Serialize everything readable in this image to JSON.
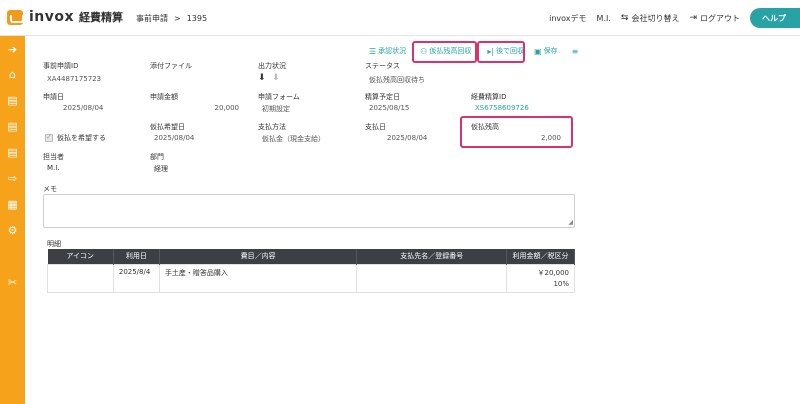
{
  "brand": {
    "logo_text": "invox",
    "logo_sub": "経費精算"
  },
  "breadcrumb": {
    "parent": "事前申請",
    "separator": ">",
    "current": "1395"
  },
  "topright": {
    "org": "invoxデモ",
    "user": "M.I.",
    "switch_company": "会社切り替え",
    "logout": "ログアウト",
    "help": "ヘルプ"
  },
  "toolbar": {
    "approval_status": "承認状況",
    "advance_collect": "仮払残高回収",
    "collect_later": "後で回収",
    "save": "保存"
  },
  "fields": {
    "request_id_label": "事前申請ID",
    "request_id": "XA4487175723",
    "attachment_label": "添付ファイル",
    "output_status_label": "出力状況",
    "status_label": "ステータス",
    "status": "仮払残高回収待ち",
    "request_date_label": "申請日",
    "request_date": "2025/08/04",
    "amount_label": "申請金額",
    "amount": "20,000",
    "form_label": "申請フォーム",
    "form": "初期設定",
    "settle_date_label": "精算予定日",
    "settle_date": "2025/08/15",
    "expense_id_label": "経費精算ID",
    "expense_id": "XS6758609726",
    "advance_wish_date_label": "仮払希望日",
    "advance_wish_date": "2025/08/04",
    "payment_method_label": "支払方法",
    "payment_method": "仮払金（現金支給）",
    "payment_date_label": "支払日",
    "payment_date": "2025/08/04",
    "advance_balance_label": "仮払残高",
    "advance_balance": "2,000",
    "wish_advance_label": "仮払を希望する",
    "person_label": "担当者",
    "person": "M.I.",
    "dept_label": "部門",
    "dept": "経理",
    "memo_label": "メモ",
    "detail_label": "明細"
  },
  "table": {
    "headers": [
      "アイコン",
      "利用日",
      "費目／内容",
      "支払先名／登録番号",
      "利用金額／税区分"
    ],
    "rows": [
      {
        "icon": "",
        "date": "2025/8/4",
        "item": "手土産・贈答品購入",
        "payee": "",
        "amount": "￥20,000",
        "tax": "10%"
      }
    ]
  },
  "colors": {
    "accent": "#27a3a6",
    "sidebar": "#f6a21b",
    "highlight": "#d8336b",
    "table_header": "#3d3f44"
  }
}
